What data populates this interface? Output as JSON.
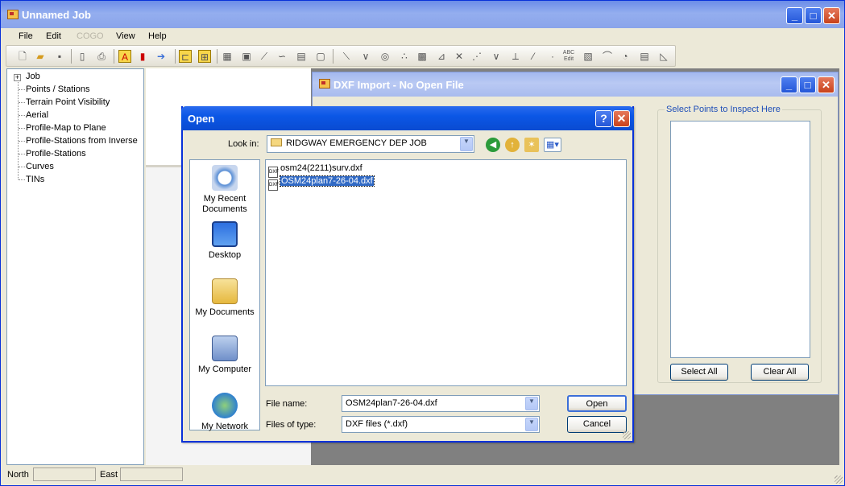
{
  "main_window": {
    "title": "Unnamed Job"
  },
  "menu": [
    {
      "label": "File",
      "enabled": true
    },
    {
      "label": "Edit",
      "enabled": true
    },
    {
      "label": "COGO",
      "enabled": false
    },
    {
      "label": "View",
      "enabled": true
    },
    {
      "label": "Help",
      "enabled": true
    }
  ],
  "tree": {
    "root": "Job",
    "expander": "+",
    "items": [
      "Points / Stations",
      "Terrain Point Visibility",
      "Aerial",
      "Profile-Map to Plane",
      "Profile-Stations from Inverse",
      "Profile-Stations",
      "Curves",
      "TINs"
    ]
  },
  "dxf_window": {
    "title": "DXF Import - No Open File",
    "group_label": "Select Points to Inspect Here",
    "select_all": "Select  All",
    "clear_all": "Clear All"
  },
  "open_dialog": {
    "title": "Open",
    "help_glyph": "?",
    "close_glyph": "✕",
    "look_in_label": "Look in:",
    "look_in_value": "RIDGWAY EMERGENCY DEP JOB",
    "places": [
      "My Recent\nDocuments",
      "Desktop",
      "My Documents",
      "My Computer",
      "My Network"
    ],
    "files": [
      {
        "name": "osm24(2211)surv.dxf",
        "selected": false
      },
      {
        "name": "OSM24plan7-26-04.dxf",
        "selected": true
      }
    ],
    "file_name_label": "File name:",
    "file_name_value": "OSM24plan7-26-04.dxf",
    "file_type_label": "Files of type:",
    "file_type_value": "DXF files (*.dxf)",
    "open_button": "Open",
    "cancel_button": "Cancel"
  },
  "statusbar": {
    "north_label": "North",
    "east_label": "East"
  },
  "colors": {
    "title_blue": "#0a4bd1",
    "selection": "#316ac5",
    "group_label": "#1f4fb8",
    "mdi_background": "#808080"
  }
}
